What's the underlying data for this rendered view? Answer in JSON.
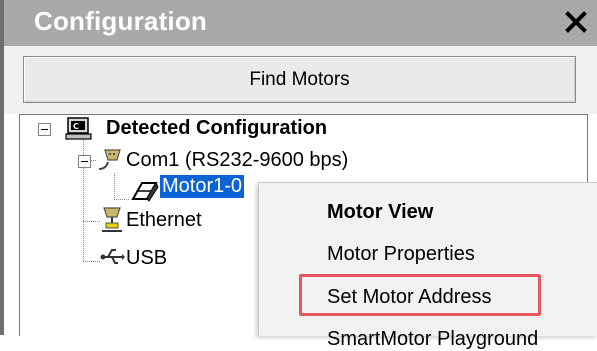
{
  "window": {
    "title": "Configuration",
    "close_label": "×"
  },
  "toolbar": {
    "find_motors_label": "Find Motors"
  },
  "tree": {
    "root": {
      "label": "Detected Configuration",
      "expander": "−",
      "icon": "computer-icon"
    },
    "com1": {
      "label": "Com1 (RS232-9600 bps)",
      "expander": "−",
      "icon": "serial-cable-icon"
    },
    "motor1": {
      "label": "Motor1-0",
      "icon": "motor-icon",
      "selected": true
    },
    "ethernet": {
      "label": "Ethernet",
      "icon": "ethernet-icon"
    },
    "usb": {
      "label": "USB",
      "icon": "usb-icon"
    }
  },
  "context_menu": {
    "items": [
      {
        "label": "Motor View",
        "bold": true
      },
      {
        "label": "Motor Properties",
        "bold": false
      },
      {
        "label": "Set Motor Address",
        "bold": false,
        "highlighted": true
      },
      {
        "label": "SmartMotor Playground",
        "bold": false
      }
    ]
  },
  "colors": {
    "title_bar": "#a9a9a9",
    "selection": "#0a64d8",
    "highlight_border": "#e5585f",
    "menu_background": "#f2f2f2"
  }
}
